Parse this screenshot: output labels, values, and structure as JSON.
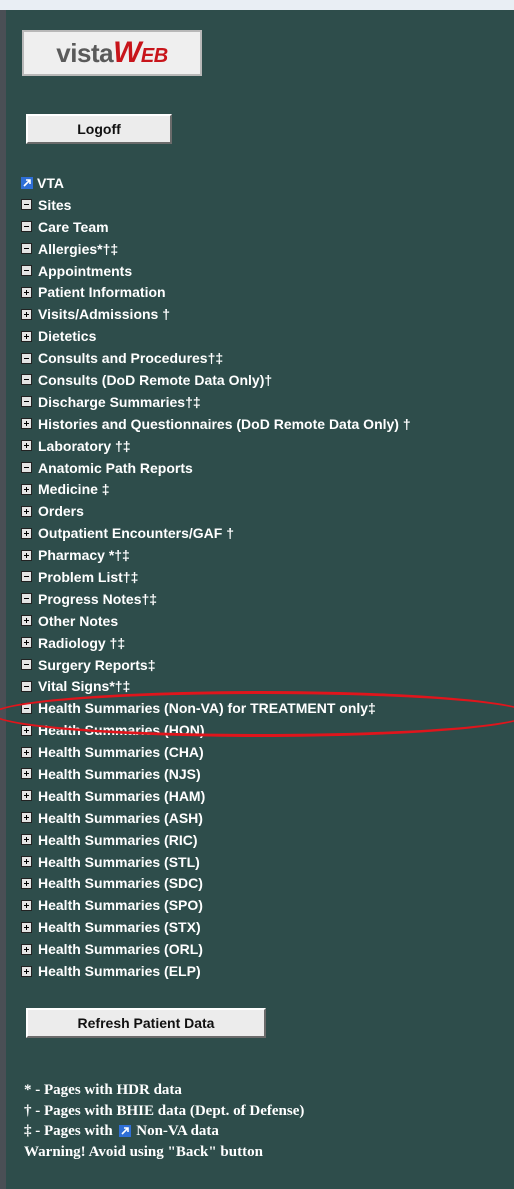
{
  "logo": {
    "text_vista": "vista",
    "text_w": "W",
    "text_eb": "EB"
  },
  "logoff_label": "Logoff",
  "refresh_label": "Refresh Patient Data",
  "menu": [
    {
      "label": "VTA",
      "icon": "external-link-icon"
    },
    {
      "label": "Sites",
      "icon": "minus"
    },
    {
      "label": "Care Team",
      "icon": "minus"
    },
    {
      "label": "Allergies*†‡",
      "icon": "minus"
    },
    {
      "label": "Appointments",
      "icon": "minus"
    },
    {
      "label": "Patient Information",
      "icon": "plus"
    },
    {
      "label": "Visits/Admissions †",
      "icon": "plus"
    },
    {
      "label": "Dietetics",
      "icon": "plus"
    },
    {
      "label": "Consults and Procedures†‡",
      "icon": "minus"
    },
    {
      "label": "Consults (DoD Remote Data Only)†",
      "icon": "minus"
    },
    {
      "label": "Discharge Summaries†‡",
      "icon": "minus"
    },
    {
      "label": "Histories and Questionnaires (DoD Remote Data Only) †",
      "icon": "plus"
    },
    {
      "label": "Laboratory †‡",
      "icon": "plus"
    },
    {
      "label": "Anatomic Path Reports",
      "icon": "minus"
    },
    {
      "label": "Medicine ‡",
      "icon": "plus"
    },
    {
      "label": "Orders",
      "icon": "plus"
    },
    {
      "label": "Outpatient Encounters/GAF †",
      "icon": "plus"
    },
    {
      "label": "Pharmacy *†‡",
      "icon": "plus"
    },
    {
      "label": "Problem List†‡",
      "icon": "minus"
    },
    {
      "label": "Progress Notes†‡",
      "icon": "minus"
    },
    {
      "label": "Other Notes",
      "icon": "plus"
    },
    {
      "label": "Radiology †‡",
      "icon": "plus"
    },
    {
      "label": "Surgery Reports‡",
      "icon": "minus"
    },
    {
      "label": "Vital Signs*†‡",
      "icon": "minus"
    },
    {
      "label": "Health Summaries (Non-VA) for TREATMENT only‡",
      "icon": "minus"
    },
    {
      "label": "Health Summaries (HON)",
      "icon": "plus"
    },
    {
      "label": "Health Summaries (CHA)",
      "icon": "plus"
    },
    {
      "label": "Health Summaries (NJS)",
      "icon": "plus"
    },
    {
      "label": "Health Summaries (HAM)",
      "icon": "plus"
    },
    {
      "label": "Health Summaries (ASH)",
      "icon": "plus"
    },
    {
      "label": "Health Summaries (RIC)",
      "icon": "plus"
    },
    {
      "label": "Health Summaries (STL)",
      "icon": "plus"
    },
    {
      "label": "Health Summaries (SDC)",
      "icon": "plus"
    },
    {
      "label": "Health Summaries (SPO)",
      "icon": "plus"
    },
    {
      "label": "Health Summaries (STX)",
      "icon": "plus"
    },
    {
      "label": "Health Summaries (ORL)",
      "icon": "plus"
    },
    {
      "label": "Health Summaries (ELP)",
      "icon": "plus"
    }
  ],
  "legend": {
    "hdr": "* - Pages with HDR data",
    "bhie": "† - Pages with BHIE data (Dept. of Defense)",
    "nonva_prefix": "‡ - Pages with",
    "nonva_suffix": "Non-VA data",
    "warning": "Warning! Avoid using \"Back\" button"
  },
  "colors": {
    "panel_bg": "#2e4d4b",
    "highlight": "#e0151c",
    "logo_red": "#c8151b"
  }
}
